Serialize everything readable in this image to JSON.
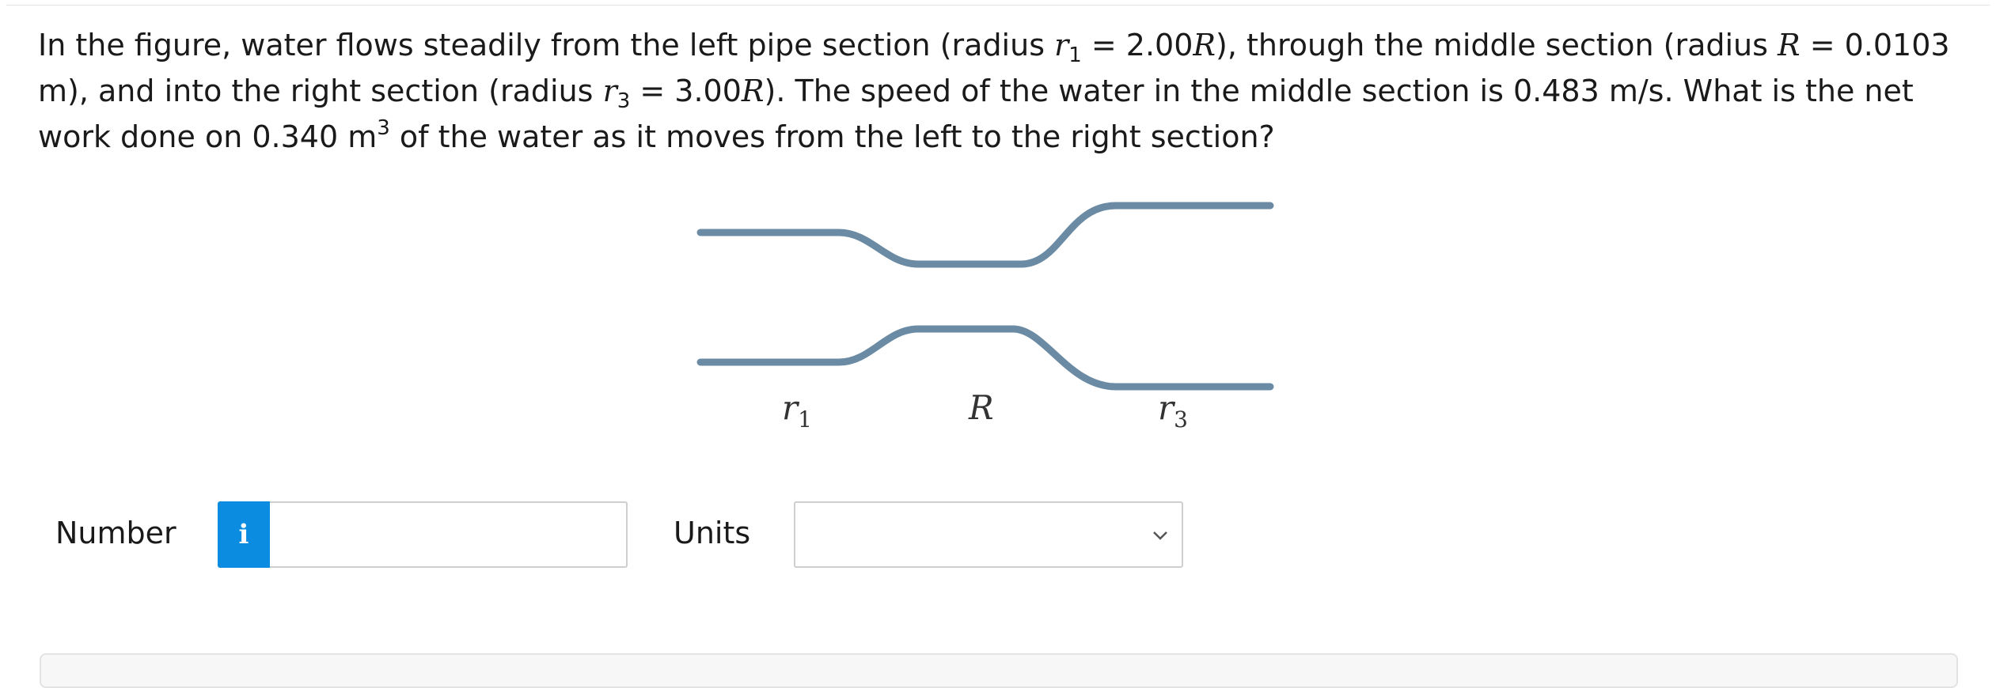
{
  "question": {
    "p1": "In the figure, water flows steadily from the left pipe section (radius ",
    "r1_sym": "r",
    "r1_sub": "1",
    "p2": " = 2.00",
    "R_sym1": "R",
    "p3": "), through the middle section (radius ",
    "R_sym2": "R",
    "p4": " = 0.0103 m), and into the right section (radius ",
    "r3_sym": "r",
    "r3_sub": "3",
    "p5": " = 3.00",
    "R_sym3": "R",
    "p6": "). The speed of the water in the middle section is 0.483 m/s. What is the net work done on 0.340 m",
    "sup": "3",
    "p7": " of the water as it moves from the left to the right section?"
  },
  "figure": {
    "label_r1": "r",
    "label_r1_sub": "1",
    "label_R": "R",
    "label_r3": "r",
    "label_r3_sub": "3",
    "pipe_color": "#6b8ba4"
  },
  "answer": {
    "number_label": "Number",
    "info_icon": "i",
    "number_value": "",
    "units_label": "Units",
    "units_value": ""
  },
  "colors": {
    "info_button": "#0c8ce0",
    "border": "#cfcfcf"
  }
}
